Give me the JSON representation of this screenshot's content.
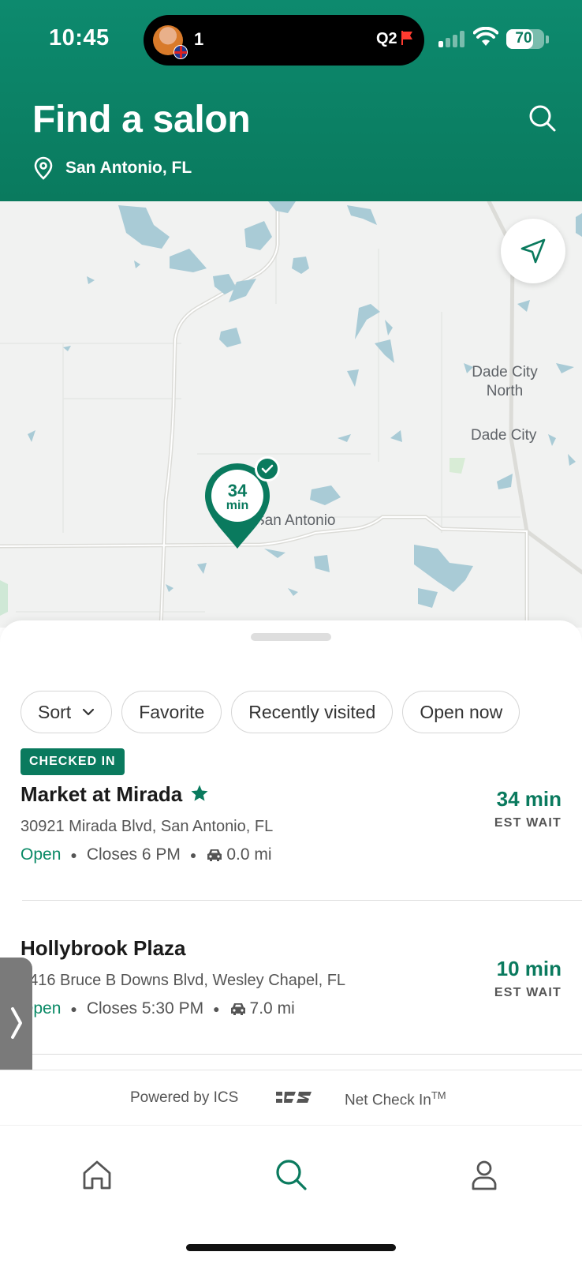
{
  "status_bar": {
    "time": "10:45",
    "activity_count": "1",
    "activity_label": "Q2",
    "battery": "70",
    "battery_level": 0.7
  },
  "header": {
    "title": "Find a salon",
    "location": "San Antonio, FL",
    "search_icon": "search-icon",
    "location_icon": "location-pin-icon"
  },
  "map": {
    "labels": {
      "dade_city_north": "Dade City\nNorth",
      "dade_city": "Dade City",
      "san_antonio": "San Antonio"
    },
    "pin": {
      "wait_value": "34",
      "wait_unit": "min"
    },
    "locate_icon": "navigation-arrow-icon"
  },
  "filters": {
    "sort": "Sort",
    "favorite": "Favorite",
    "recently_visited": "Recently visited",
    "open_now": "Open now"
  },
  "salons": [
    {
      "badge": "CHECKED IN",
      "name": "Market at Mirada",
      "favorite": true,
      "address": "30921 Mirada Blvd, San Antonio, FL",
      "status": "Open",
      "closes": "Closes 6 PM",
      "distance": "0.0 mi",
      "wait": "34 min",
      "wait_label": "EST WAIT"
    },
    {
      "name": "Hollybrook Plaza",
      "favorite": false,
      "address": "2416 Bruce B Downs Blvd, Wesley Chapel, FL",
      "status": "Open",
      "closes": "Closes 5:30 PM",
      "distance": "7.0 mi",
      "wait": "10 min",
      "wait_label": "EST WAIT"
    }
  ],
  "footer": {
    "powered_by": "Powered by ICS",
    "net_check_in": "Net Check In",
    "trademark": "TM"
  },
  "tabs": {
    "home": "home-icon",
    "search": "search-icon",
    "profile": "profile-icon"
  },
  "colors": {
    "brand": "#0a7a5e",
    "water": "#a9cbd6",
    "map_bg": "#f1f2f1"
  }
}
